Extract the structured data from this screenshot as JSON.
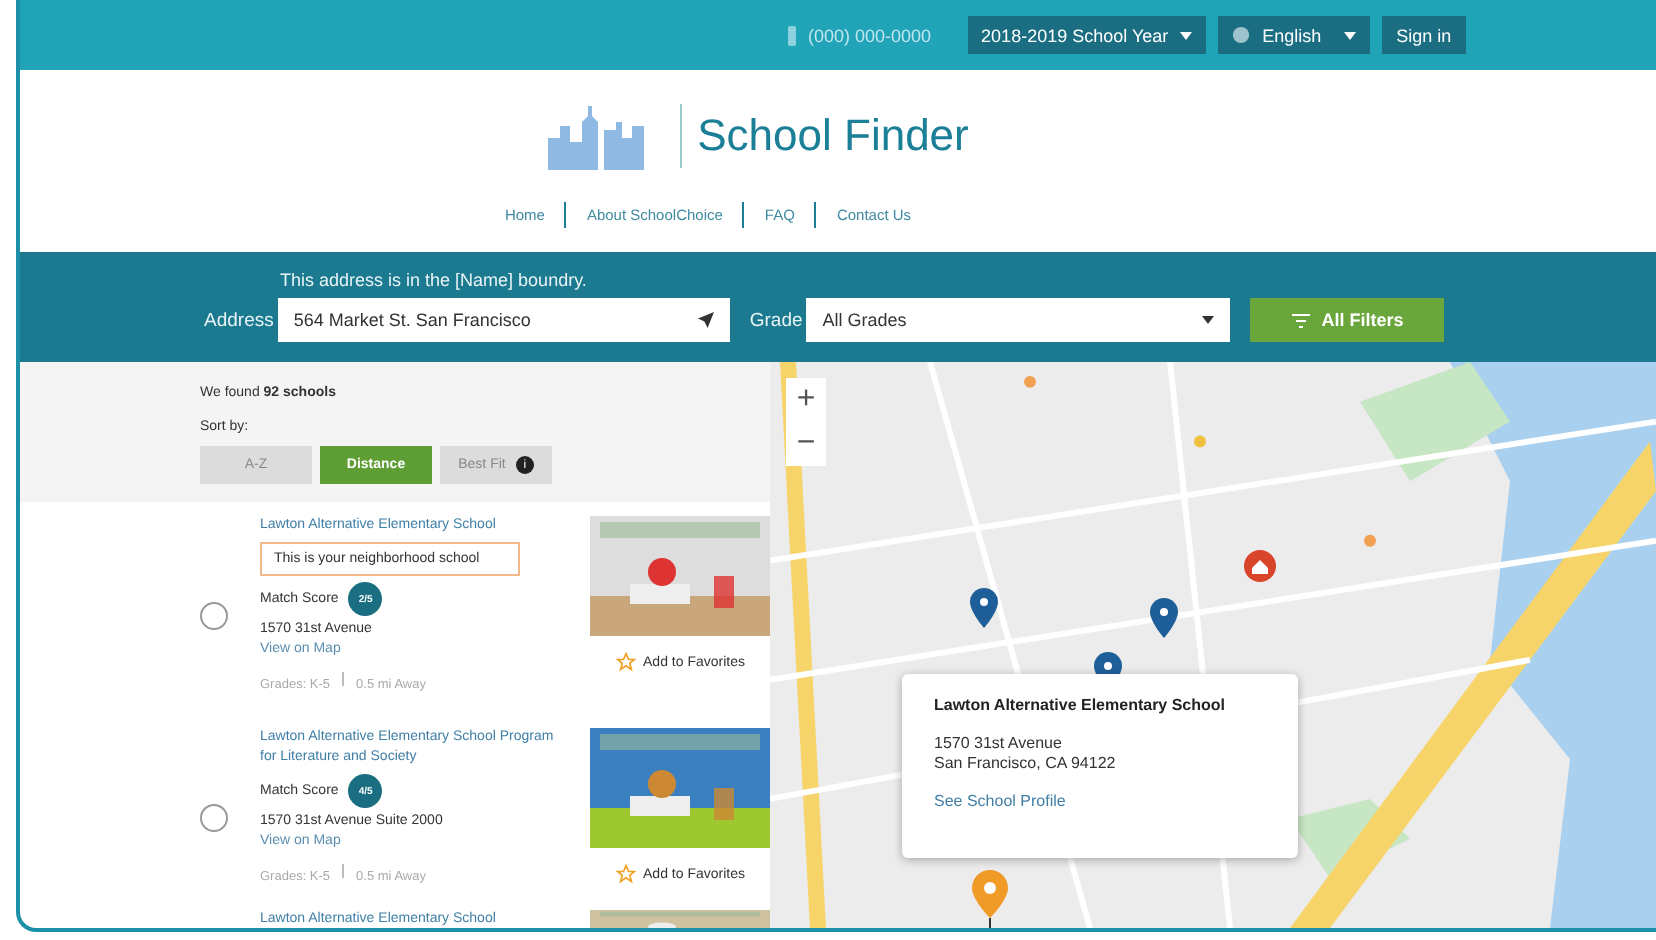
{
  "top_bar": {
    "phone": "(000) 000-0000",
    "school_year": "2018-2019 School Year",
    "language": "English",
    "sign_in": "Sign in"
  },
  "header": {
    "title": "School Finder",
    "nav": [
      "Home",
      "About SchoolChoice",
      "FAQ",
      "Contact Us"
    ]
  },
  "search": {
    "notice": "This address is in the [Name] boundry.",
    "address_label": "Address",
    "address_value": "564 Market St. San Francisco",
    "grade_label": "Grade",
    "grade_value": "All Grades",
    "filters_button": "All Filters"
  },
  "results": {
    "summary": "We found **92 schools**",
    "sort_label": "Sort by:",
    "sort_options": [
      {
        "label": "A-Z",
        "selected": false
      },
      {
        "label": "Distance",
        "selected": true
      },
      {
        "label": "Best Fit",
        "selected": false,
        "info_icon": "i"
      }
    ]
  },
  "schools": [
    {
      "name": "Lawton Alternative Elementary School",
      "neighborhood": "This is your neighborhood school",
      "match_label": "Match Score",
      "match_score": "2/5",
      "address": "1570 31st Avenue",
      "map_link": "View on Map",
      "grades": "Grades: K-5",
      "distance": "0.5 mi Away",
      "favorite": "Add to Favorites",
      "selected": false
    },
    {
      "name": "Lawton Alternative Elementary School Program for Literature and Society",
      "match_label": "Match Score",
      "match_score": "4/5",
      "address": "1570 31st Avenue Suite 2000",
      "map_link": "View on Map",
      "grades": "Grades: K-5",
      "distance": "0.5 mi Away",
      "favorite": "Add to Favorites",
      "selected": false
    },
    {
      "name": "Lawton Alternative Elementary School"
    }
  ],
  "map": {
    "zoom_in": "+",
    "zoom_out": "−",
    "popup": {
      "name": "Lawton Alternative Elementary School",
      "address_line1": "1570 31st Avenue",
      "address_line2": "San Francisco, CA 94122",
      "link": "See School Profile"
    }
  }
}
